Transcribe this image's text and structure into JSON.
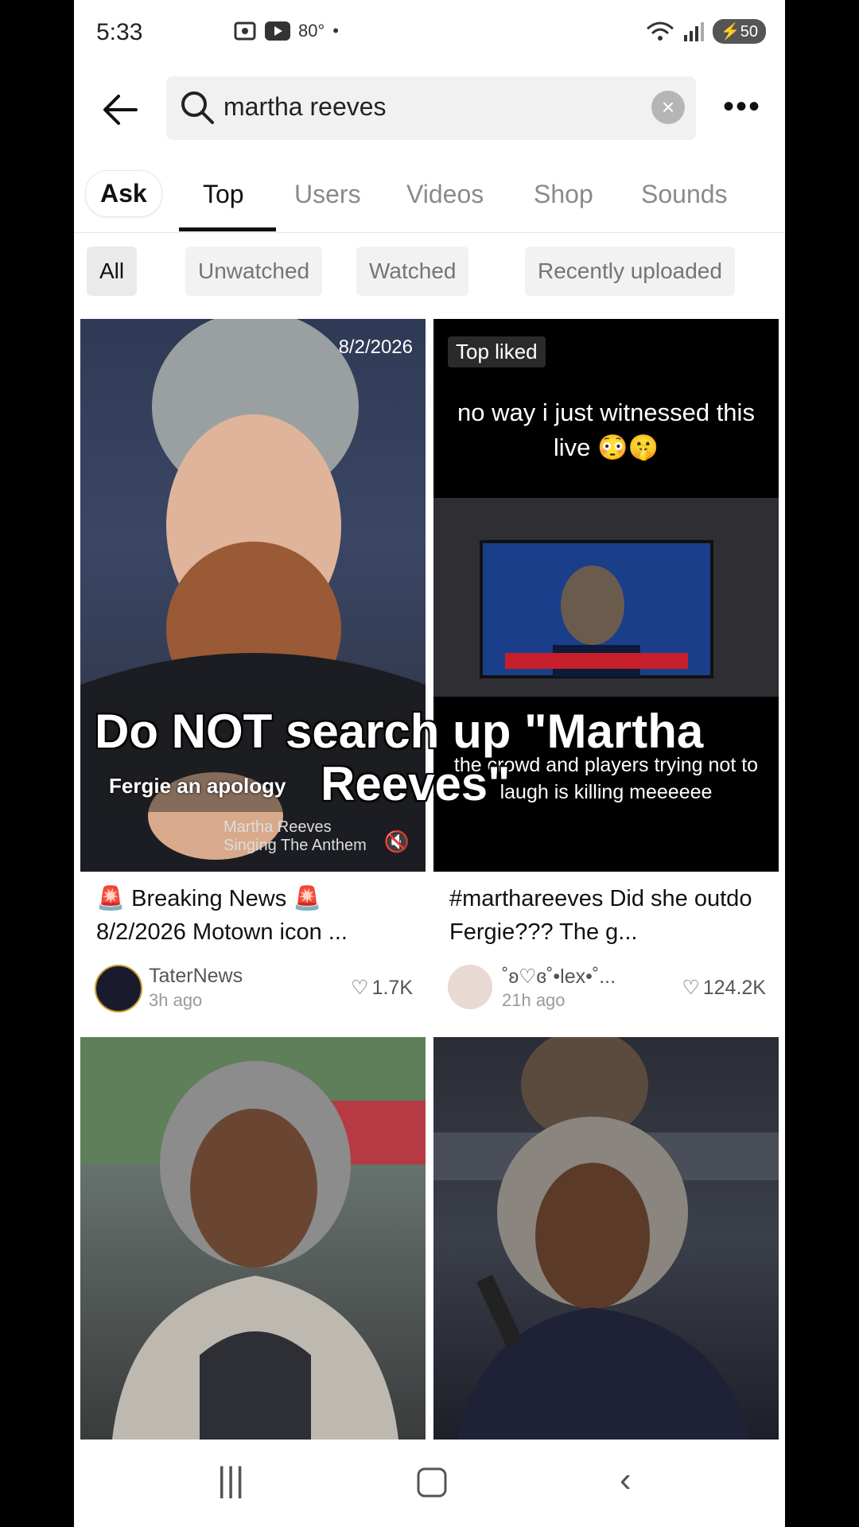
{
  "status_bar": {
    "time": "5:33",
    "temperature": "80°",
    "battery": "50"
  },
  "search": {
    "query": "martha reeves"
  },
  "tabs": {
    "ask": "Ask",
    "top": "Top",
    "users": "Users",
    "videos": "Videos",
    "shop": "Shop",
    "sounds": "Sounds"
  },
  "filters": {
    "all": "All",
    "unwatched": "Unwatched",
    "watched": "Watched",
    "recent": "Recently uploaded"
  },
  "cards": [
    {
      "date": "8/2/2026",
      "title": "🚨 Breaking News 🚨 8/2/2026 Motown icon ...",
      "author": "TaterNews",
      "ago": "3h ago",
      "likes": "1.7K",
      "caption": "Fergie an apology",
      "overlay_small": "Martha Reeves Singing The Anthem"
    },
    {
      "badge": "Top liked",
      "top_caption": "no way i just witnessed this live 😳🤫",
      "bottom_caption": "the crowd and players trying not to laugh is killing meeeeee",
      "title": "#marthareeves Did she outdo Fergie??? The g...",
      "author": "˚ʚ♡ɞ˚•lex•˚...",
      "ago": "21h ago",
      "likes": "124.2K"
    }
  ],
  "overlay_text": {
    "line1": "Do NOT search up \"Martha",
    "line2": "Reeves\""
  }
}
